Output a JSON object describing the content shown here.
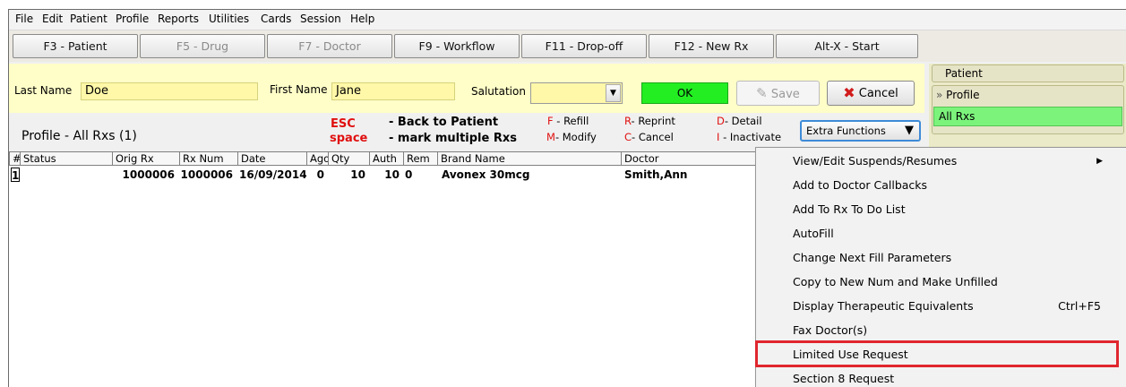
{
  "menu": [
    "File",
    "Edit",
    "Patient",
    "Profile",
    "Reports",
    "Utilities",
    "Cards",
    "Session",
    "Help"
  ],
  "toolbar": [
    {
      "label": "F3 - Patient",
      "enabled": true
    },
    {
      "label": "F5 - Drug",
      "enabled": false
    },
    {
      "label": "F7 - Doctor",
      "enabled": false
    },
    {
      "label": "F9 - Workflow",
      "enabled": true
    },
    {
      "label": "F11 - Drop-off",
      "enabled": true
    },
    {
      "label": "F12 - New Rx",
      "enabled": true
    },
    {
      "label": "Alt-X - Start",
      "enabled": true
    }
  ],
  "search": {
    "last_name_label": "Last Name",
    "last_name_value": "Doe",
    "first_name_label": "First Name",
    "first_name_value": "Jane",
    "salutation_label": "Salutation",
    "salutation_value": "",
    "ok_label": "OK",
    "save_label": "Save",
    "cancel_label": "Cancel"
  },
  "profile": {
    "title": "Profile - All Rxs (1)",
    "esc_key": "ESC",
    "esc_text": "- Back to Patient",
    "space_key": "space",
    "space_text": "- mark multiple Rxs",
    "hotkeys": [
      {
        "key": "F",
        "text": "- Refill"
      },
      {
        "key": "M",
        "text": "- Modify"
      },
      {
        "key": "R",
        "text": "- Reprint"
      },
      {
        "key": "C",
        "text": "- Cancel"
      },
      {
        "key": "D",
        "text": "- Detail"
      },
      {
        "key": "I",
        "text": "- Inactivate"
      }
    ],
    "extra_functions_label": "Extra Functions"
  },
  "grid": {
    "columns": [
      "#",
      "Status",
      "Orig Rx",
      "Rx Num",
      "Date",
      "Ago",
      "Qty",
      "Auth",
      "Rem",
      "Brand Name",
      "Doctor"
    ],
    "rows": [
      [
        "1",
        "",
        "1000006",
        "1000006",
        "16/09/2014",
        "0",
        "10",
        "10",
        "0",
        "Avonex 30mcg",
        "Smith,Ann"
      ]
    ]
  },
  "right_panel": {
    "patient_label": "Patient",
    "profile_label": "Profile",
    "all_rxs_label": "All Rxs"
  },
  "context_menu": {
    "items": [
      {
        "label": "View/Edit Suspends/Resumes",
        "shortcut": "",
        "submenu": true
      },
      {
        "label": "Add to Doctor Callbacks",
        "shortcut": "",
        "submenu": false
      },
      {
        "label": "Add To Rx To Do List",
        "shortcut": "",
        "submenu": false
      },
      {
        "label": "AutoFill",
        "shortcut": "",
        "submenu": false
      },
      {
        "label": "Change Next Fill Parameters",
        "shortcut": "",
        "submenu": false
      },
      {
        "label": "Copy to New Num and Make Unfilled",
        "shortcut": "",
        "submenu": false
      },
      {
        "label": "Display Therapeutic Equivalents",
        "shortcut": "Ctrl+F5",
        "submenu": false
      },
      {
        "label": "Fax Doctor(s)",
        "shortcut": "",
        "submenu": false
      },
      {
        "label": "Limited Use Request",
        "shortcut": "",
        "submenu": false
      },
      {
        "label": "Section 8 Request",
        "shortcut": "",
        "submenu": false
      }
    ],
    "highlighted": "Limited Use Request"
  },
  "colors": {
    "search_bg": "#fffec8",
    "ok_green": "#22ee22",
    "hotkey_red": "#e01010",
    "highlight_red": "#e0262e",
    "right_panel_active": "#7cf47c"
  }
}
